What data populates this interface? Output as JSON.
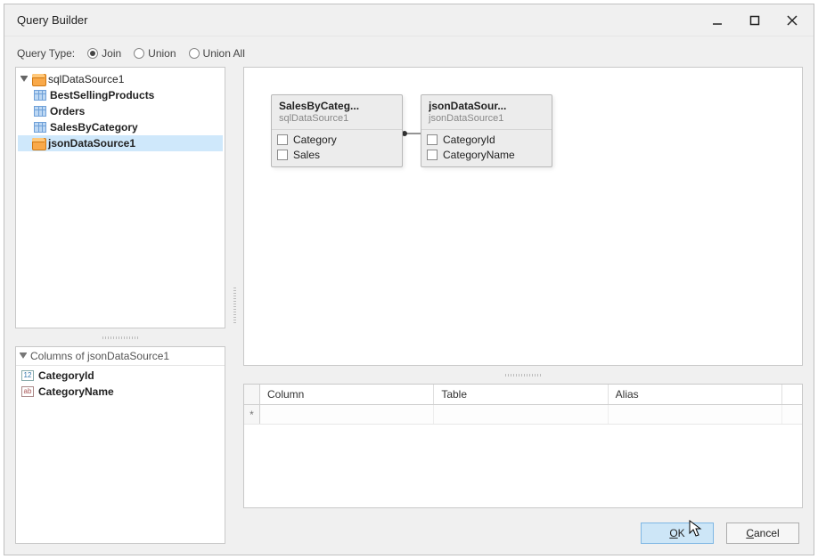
{
  "window": {
    "title": "Query Builder"
  },
  "queryType": {
    "label": "Query Type:",
    "options": [
      {
        "label": "Join",
        "checked": true
      },
      {
        "label": "Union",
        "checked": false
      },
      {
        "label": "Union All",
        "checked": false
      }
    ]
  },
  "tree": {
    "root": {
      "label": "sqlDataSource1",
      "icon": "datasource",
      "children": [
        {
          "label": "BestSellingProducts",
          "icon": "table"
        },
        {
          "label": "Orders",
          "icon": "table"
        },
        {
          "label": "SalesByCategory",
          "icon": "table"
        }
      ]
    },
    "selected": {
      "label": "jsonDataSource1",
      "icon": "datasource"
    }
  },
  "columnsPanel": {
    "title": "Columns of jsonDataSource1",
    "columns": [
      {
        "label": "CategoryId",
        "type": "num"
      },
      {
        "label": "CategoryName",
        "type": "str"
      }
    ]
  },
  "canvas": {
    "cards": [
      {
        "name": "SalesByCateg...",
        "source": "sqlDataSource1",
        "fields": [
          "Category",
          "Sales"
        ]
      },
      {
        "name": "jsonDataSour...",
        "source": "jsonDataSource1",
        "fields": [
          "CategoryId",
          "CategoryName"
        ]
      }
    ]
  },
  "grid": {
    "headers": {
      "column": "Column",
      "table": "Table",
      "alias": "Alias"
    },
    "newRowMarker": "*"
  },
  "footer": {
    "ok": {
      "full": "OK",
      "ul": "O",
      "rest": "K"
    },
    "cancel": {
      "full": "Cancel",
      "ul": "C",
      "rest": "ancel"
    }
  }
}
